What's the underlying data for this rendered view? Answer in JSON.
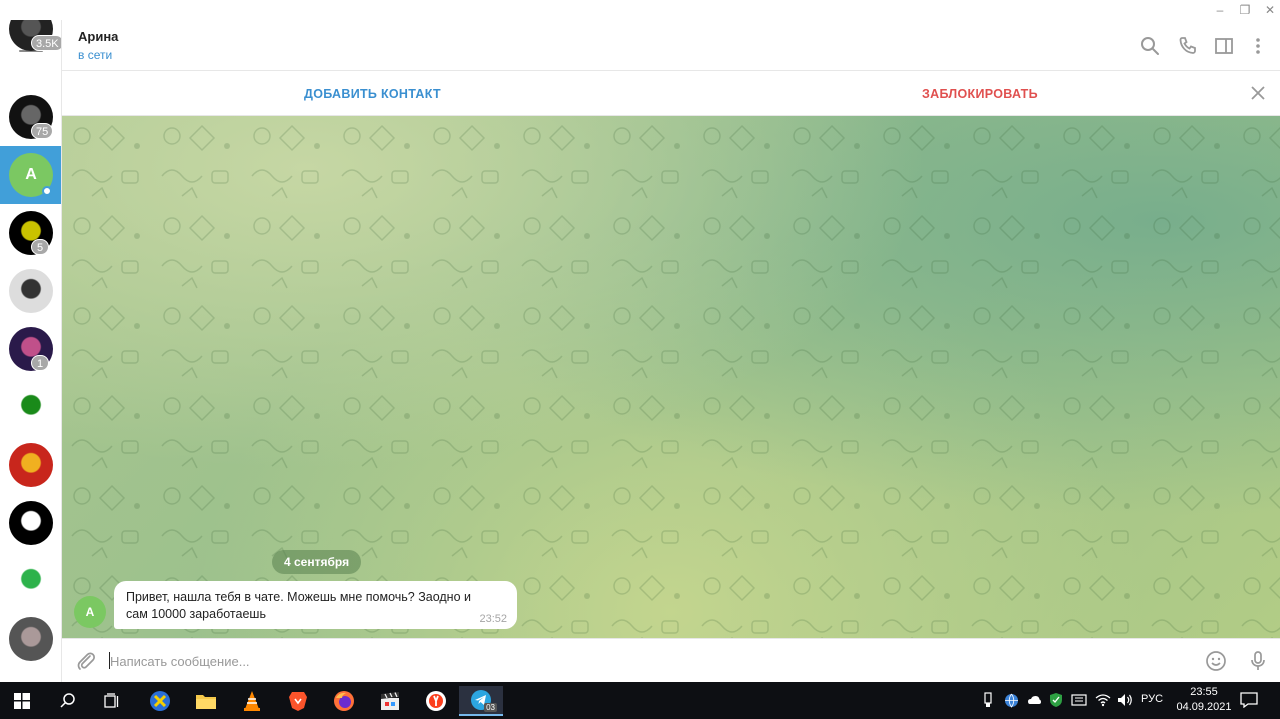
{
  "window": {
    "controls": [
      "minimize",
      "restore",
      "close"
    ]
  },
  "sidebar": {
    "chats": [
      {
        "badge": "3.5K",
        "colors": [
          "#222",
          "#555"
        ]
      },
      {
        "badge": "75",
        "colors": [
          "#111",
          "#666"
        ]
      },
      {
        "letter": "A",
        "color": "#7bc862",
        "selected": true,
        "online": true
      },
      {
        "badge": "5",
        "colors": [
          "#000",
          "#c9c200"
        ]
      },
      {
        "badge": "",
        "colors": [
          "#ddd",
          "#333"
        ]
      },
      {
        "badge": "1",
        "colors": [
          "#2a1a4a",
          "#c0508a"
        ]
      },
      {
        "badge": "",
        "colors": [
          "#fff",
          "#1a8a1a"
        ]
      },
      {
        "badge": "",
        "colors": [
          "#c8261c",
          "#f0b020"
        ]
      },
      {
        "badge": "",
        "colors": [
          "#000",
          "#fff"
        ]
      },
      {
        "badge": "",
        "colors": [
          "#fff",
          "#2db24b"
        ]
      },
      {
        "badge": "",
        "colors": [
          "#555",
          "#a99"
        ]
      }
    ]
  },
  "header": {
    "name": "Арина",
    "status": "в сети"
  },
  "actions": {
    "add_contact": "ДОБАВИТЬ КОНТАКТ",
    "block": "ЗАБЛОКИРОВАТЬ"
  },
  "chat": {
    "date": "4 сентября",
    "messages": [
      {
        "avatar_letter": "A",
        "text": "Привет, нашла тебя в чате. Можешь мне помочь? Заодно и сам 10000 заработаешь",
        "time": "23:52"
      }
    ]
  },
  "composer": {
    "placeholder": "Написать сообщение..."
  },
  "taskbar": {
    "language": "РУС",
    "time": "23:55",
    "date": "04.09.2021",
    "telegram_badge": "03"
  },
  "colors": {
    "accent": "#419fd9",
    "link": "#3a8fd0",
    "danger": "#e0504f",
    "avatar_green": "#7bc862"
  }
}
